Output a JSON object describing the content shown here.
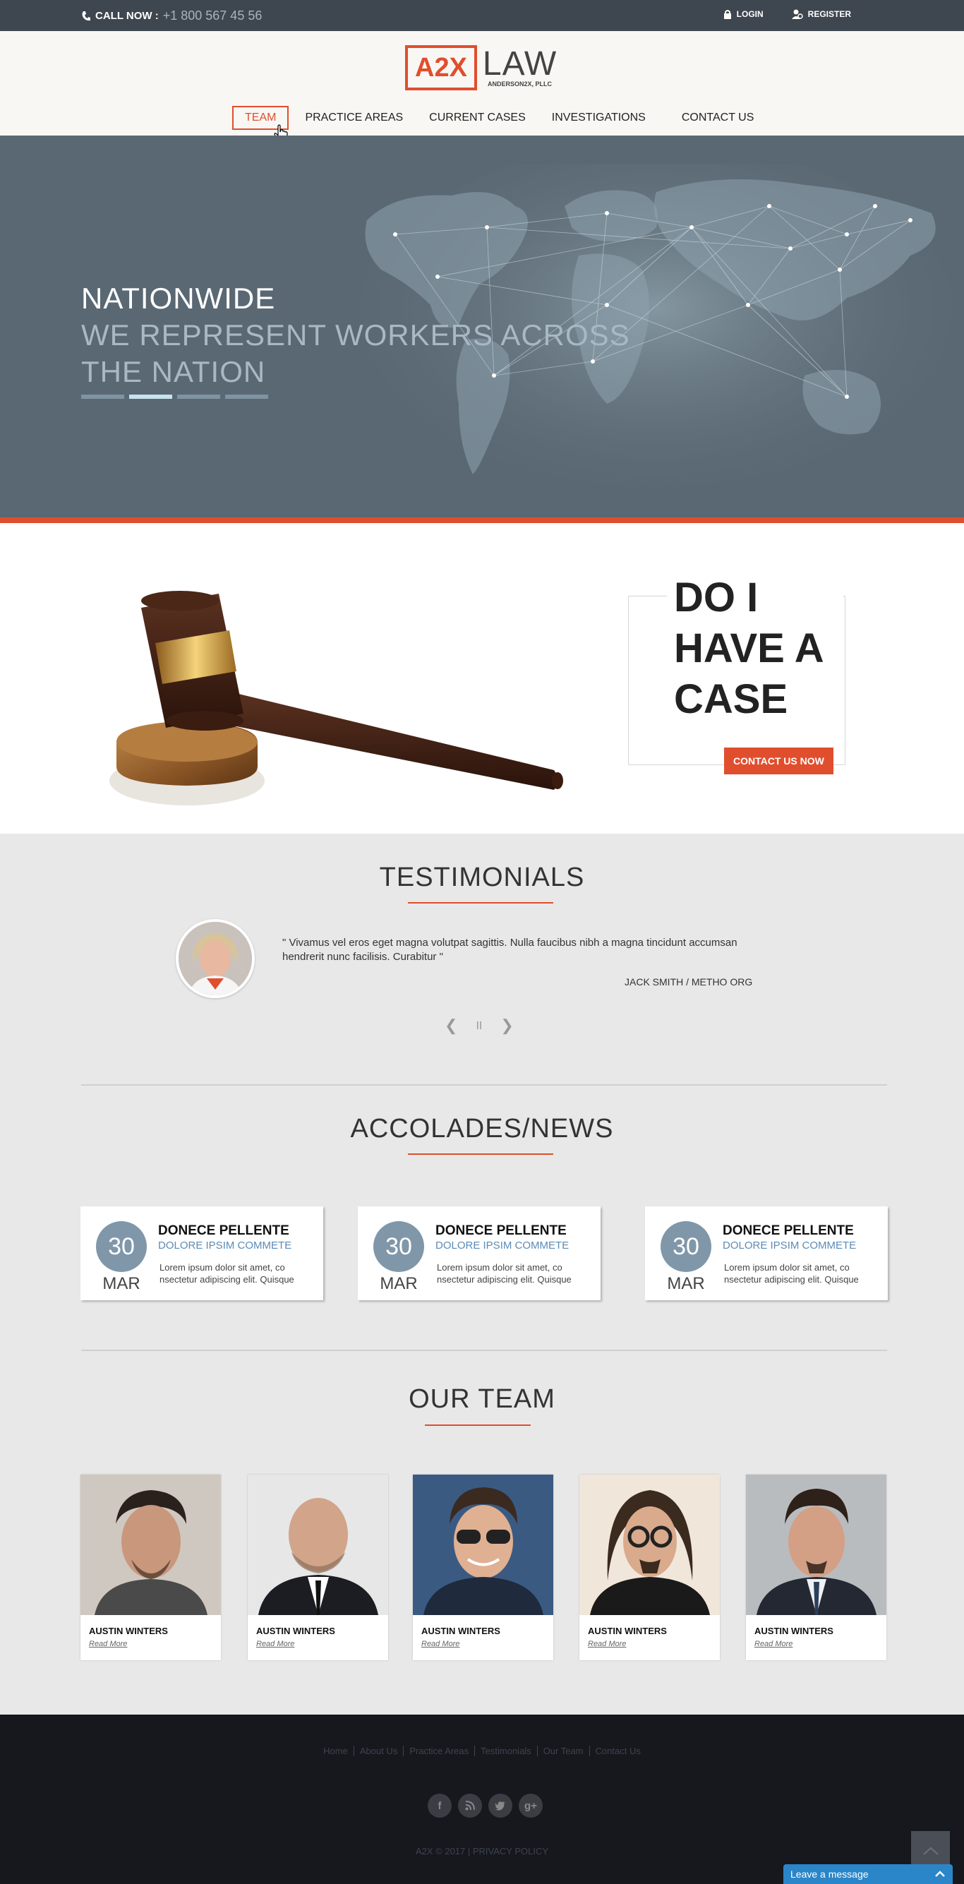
{
  "topbar": {
    "call_label": "CALL NOW :",
    "phone": "+1 800 567 45 56",
    "login": "LOGIN",
    "register": "REGISTER"
  },
  "logo": {
    "box": "A2X",
    "law": "LAW",
    "sub": "ANDERSON2X, PLLC"
  },
  "nav": {
    "items": [
      "TEAM",
      "PRACTICE AREAS",
      "CURRENT CASES",
      "INVESTIGATIONS",
      "CONTACT US"
    ],
    "active_index": 0
  },
  "hero": {
    "title": "NATIONWIDE",
    "line1": "WE REPRESENT WORKERS ACROSS",
    "line2": "THE NATION",
    "slides": 4,
    "active_slide": 1
  },
  "case": {
    "title": "DO I HAVE A CASE",
    "button": "CONTACT US NOW"
  },
  "testimonials": {
    "title": "TESTIMONIALS",
    "quote": "\" Vivamus vel eros eget magna volutpat sagittis. Nulla faucibus nibh a magna tincidunt accumsan hendrerit nunc facilisis. Curabitur \"",
    "author": "JACK SMITH / METHO ORG",
    "prev": "❮",
    "pause": "II",
    "next": "❯"
  },
  "news": {
    "title": "ACCOLADES/NEWS",
    "cards": [
      {
        "day": "30",
        "month": "MAR",
        "title": "DONECE PELLENTE",
        "subtitle": "DOLORE IPSIM COMMETE",
        "text": "Lorem ipsum dolor sit amet, co nsectetur adipiscing elit. Quisque"
      },
      {
        "day": "30",
        "month": "MAR",
        "title": "DONECE PELLENTE",
        "subtitle": "DOLORE IPSIM COMMETE",
        "text": "Lorem ipsum dolor sit amet, co nsectetur adipiscing elit. Quisque"
      },
      {
        "day": "30",
        "month": "MAR",
        "title": "DONECE PELLENTE",
        "subtitle": "DOLORE IPSIM COMMETE",
        "text": "Lorem ipsum dolor sit amet, co nsectetur adipiscing elit. Quisque"
      }
    ]
  },
  "team": {
    "title": "OUR TEAM",
    "members": [
      {
        "name": "AUSTIN WINTERS",
        "link": "Read More"
      },
      {
        "name": "AUSTIN WINTERS",
        "link": "Read More"
      },
      {
        "name": "AUSTIN WINTERS",
        "link": "Read More"
      },
      {
        "name": "AUSTIN WINTERS",
        "link": "Read More"
      },
      {
        "name": "AUSTIN WINTERS",
        "link": "Read More"
      }
    ]
  },
  "footer": {
    "links": [
      "Home",
      "About Us",
      "Practice Areas",
      "Testimonials",
      "Our Team",
      "Contact Us"
    ],
    "socials": [
      "f",
      "rss",
      "t",
      "g+"
    ],
    "copyright": "A2X © 2017 | PRIVACY POLICY",
    "chat": "Leave a message"
  },
  "colors": {
    "accent": "#e04e2e",
    "topbar": "#3e4650",
    "hero": "#5a6873",
    "footer": "#16181d"
  }
}
